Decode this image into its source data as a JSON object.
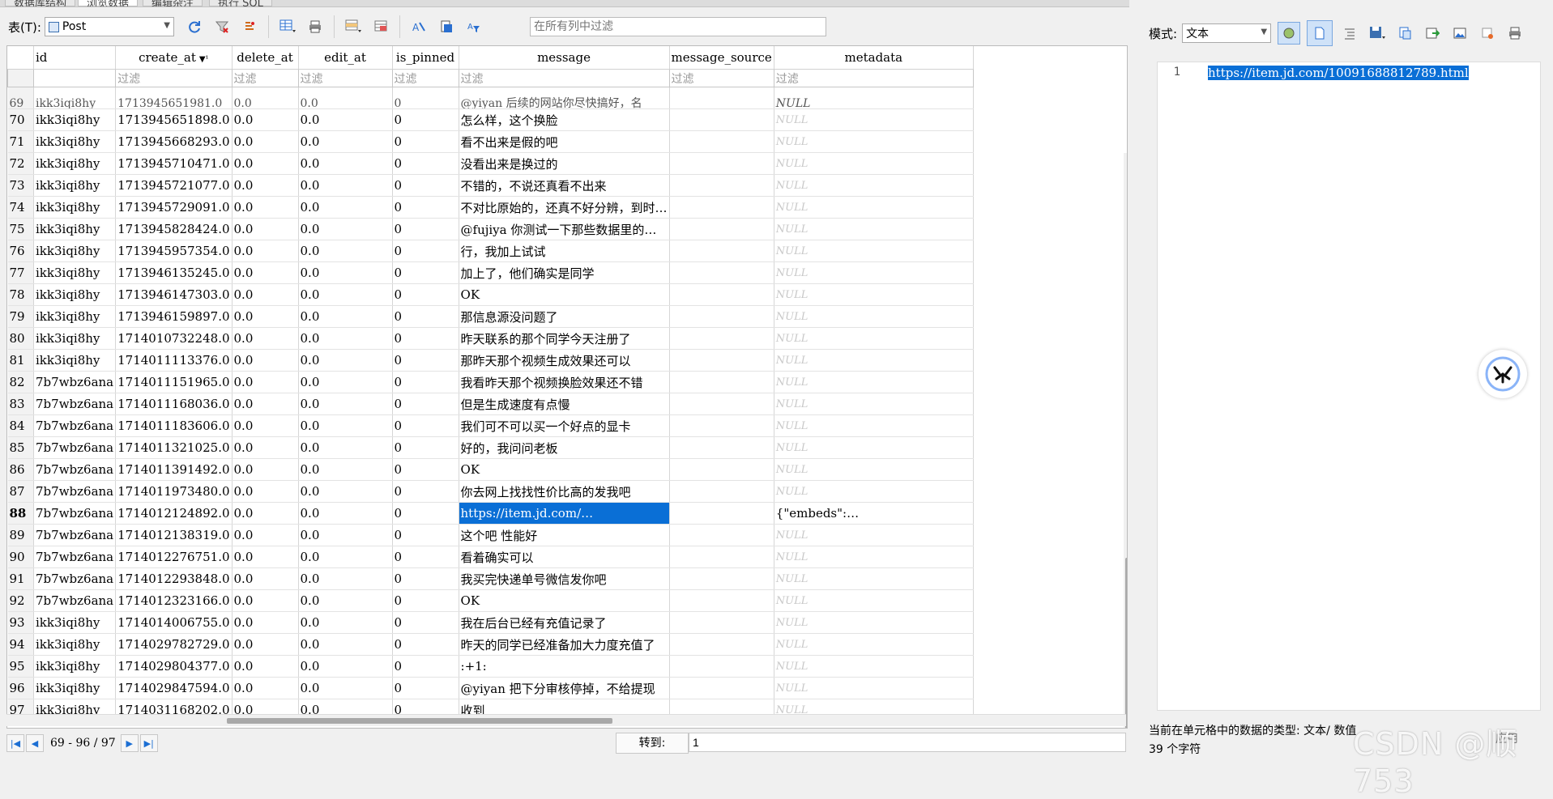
{
  "tabs": [
    {
      "label": "数据库结构"
    },
    {
      "label": "浏览数据",
      "active": true
    },
    {
      "label": "编辑杂注"
    },
    {
      "label": "执行 SQL"
    }
  ],
  "toolbar": {
    "table_label": "表(T):",
    "table_value": "Post",
    "filter_all_placeholder": "在所有列中过滤"
  },
  "grid": {
    "columns": [
      "id",
      "create_at",
      "delete_at",
      "edit_at",
      "is_pinned",
      "message",
      "message_source",
      "metadata"
    ],
    "sort_indicator": "▼¹",
    "filter_placeholder": "过滤",
    "partial_row": {
      "num": "69",
      "id": "ikk3iqi8hy",
      "create_at": "1713945651981.0",
      "delete_at": "0.0",
      "edit_at": "0.0",
      "is_pinned": "0",
      "message": "@yiyan 后续的网站你尽快搞好，名",
      "metadata": "NULL"
    },
    "null_text": "NULL",
    "rows": [
      {
        "num": "70",
        "id": "ikk3iqi8hy",
        "create_at": "1713945651898.0",
        "delete_at": "0.0",
        "edit_at": "0.0",
        "is_pinned": "0",
        "message": "怎么样，这个换脸",
        "message_source": "",
        "metadata": "NULL"
      },
      {
        "num": "71",
        "id": "ikk3iqi8hy",
        "create_at": "1713945668293.0",
        "delete_at": "0.0",
        "edit_at": "0.0",
        "is_pinned": "0",
        "message": "看不出来是假的吧",
        "message_source": "",
        "metadata": "NULL"
      },
      {
        "num": "72",
        "id": "ikk3iqi8hy",
        "create_at": "1713945710471.0",
        "delete_at": "0.0",
        "edit_at": "0.0",
        "is_pinned": "0",
        "message": "没看出来是换过的",
        "message_source": "",
        "metadata": "NULL"
      },
      {
        "num": "73",
        "id": "ikk3iqi8hy",
        "create_at": "1713945721077.0",
        "delete_at": "0.0",
        "edit_at": "0.0",
        "is_pinned": "0",
        "message": "不错的，不说还真看不出来",
        "message_source": "",
        "metadata": "NULL"
      },
      {
        "num": "74",
        "id": "ikk3iqi8hy",
        "create_at": "1713945729091.0",
        "delete_at": "0.0",
        "edit_at": "0.0",
        "is_pinned": "0",
        "message": "不对比原始的，还真不好分辨，到时…",
        "message_source": "",
        "metadata": "NULL"
      },
      {
        "num": "75",
        "id": "ikk3iqi8hy",
        "create_at": "1713945828424.0",
        "delete_at": "0.0",
        "edit_at": "0.0",
        "is_pinned": "0",
        "message": "@fujiya 你测试一下那些数据里的…",
        "message_source": "",
        "metadata": "NULL"
      },
      {
        "num": "76",
        "id": "ikk3iqi8hy",
        "create_at": "1713945957354.0",
        "delete_at": "0.0",
        "edit_at": "0.0",
        "is_pinned": "0",
        "message": "行，我加上试试",
        "message_source": "",
        "metadata": "NULL"
      },
      {
        "num": "77",
        "id": "ikk3iqi8hy",
        "create_at": "1713946135245.0",
        "delete_at": "0.0",
        "edit_at": "0.0",
        "is_pinned": "0",
        "message": "加上了，他们确实是同学",
        "message_source": "",
        "metadata": "NULL"
      },
      {
        "num": "78",
        "id": "ikk3iqi8hy",
        "create_at": "1713946147303.0",
        "delete_at": "0.0",
        "edit_at": "0.0",
        "is_pinned": "0",
        "message": "OK",
        "message_source": "",
        "metadata": "NULL"
      },
      {
        "num": "79",
        "id": "ikk3iqi8hy",
        "create_at": "1713946159897.0",
        "delete_at": "0.0",
        "edit_at": "0.0",
        "is_pinned": "0",
        "message": "那信息源没问题了",
        "message_source": "",
        "metadata": "NULL"
      },
      {
        "num": "80",
        "id": "ikk3iqi8hy",
        "create_at": "1714010732248.0",
        "delete_at": "0.0",
        "edit_at": "0.0",
        "is_pinned": "0",
        "message": "昨天联系的那个同学今天注册了",
        "message_source": "",
        "metadata": "NULL"
      },
      {
        "num": "81",
        "id": "ikk3iqi8hy",
        "create_at": "1714011113376.0",
        "delete_at": "0.0",
        "edit_at": "0.0",
        "is_pinned": "0",
        "message": "那昨天那个视频生成效果还可以",
        "message_source": "",
        "metadata": "NULL"
      },
      {
        "num": "82",
        "id": "7b7wbz6ana",
        "create_at": "1714011151965.0",
        "delete_at": "0.0",
        "edit_at": "0.0",
        "is_pinned": "0",
        "message": "我看昨天那个视频换脸效果还不错",
        "message_source": "",
        "metadata": "NULL"
      },
      {
        "num": "83",
        "id": "7b7wbz6ana",
        "create_at": "1714011168036.0",
        "delete_at": "0.0",
        "edit_at": "0.0",
        "is_pinned": "0",
        "message": "但是生成速度有点慢",
        "message_source": "",
        "metadata": "NULL"
      },
      {
        "num": "84",
        "id": "7b7wbz6ana",
        "create_at": "1714011183606.0",
        "delete_at": "0.0",
        "edit_at": "0.0",
        "is_pinned": "0",
        "message": "我们可不可以买一个好点的显卡",
        "message_source": "",
        "metadata": "NULL"
      },
      {
        "num": "85",
        "id": "7b7wbz6ana",
        "create_at": "1714011321025.0",
        "delete_at": "0.0",
        "edit_at": "0.0",
        "is_pinned": "0",
        "message": "好的，我问问老板",
        "message_source": "",
        "metadata": "NULL"
      },
      {
        "num": "86",
        "id": "7b7wbz6ana",
        "create_at": "1714011391492.0",
        "delete_at": "0.0",
        "edit_at": "0.0",
        "is_pinned": "0",
        "message": "OK",
        "message_source": "",
        "metadata": "NULL"
      },
      {
        "num": "87",
        "id": "7b7wbz6ana",
        "create_at": "1714011973480.0",
        "delete_at": "0.0",
        "edit_at": "0.0",
        "is_pinned": "0",
        "message": "你去网上找找性价比高的发我吧",
        "message_source": "",
        "metadata": "NULL"
      },
      {
        "num": "88",
        "id": "7b7wbz6ana",
        "create_at": "1714012124892.0",
        "delete_at": "0.0",
        "edit_at": "0.0",
        "is_pinned": "0",
        "message": "https://item.jd.com/…",
        "message_source": "",
        "metadata": "{\"embeds\":…",
        "current": true,
        "selected": true
      },
      {
        "num": "89",
        "id": "7b7wbz6ana",
        "create_at": "1714012138319.0",
        "delete_at": "0.0",
        "edit_at": "0.0",
        "is_pinned": "0",
        "message": "这个吧 性能好",
        "message_source": "",
        "metadata": "NULL"
      },
      {
        "num": "90",
        "id": "7b7wbz6ana",
        "create_at": "1714012276751.0",
        "delete_at": "0.0",
        "edit_at": "0.0",
        "is_pinned": "0",
        "message": "看着确实可以",
        "message_source": "",
        "metadata": "NULL"
      },
      {
        "num": "91",
        "id": "7b7wbz6ana",
        "create_at": "1714012293848.0",
        "delete_at": "0.0",
        "edit_at": "0.0",
        "is_pinned": "0",
        "message": "我买完快递单号微信发你吧",
        "message_source": "",
        "metadata": "NULL"
      },
      {
        "num": "92",
        "id": "7b7wbz6ana",
        "create_at": "1714012323166.0",
        "delete_at": "0.0",
        "edit_at": "0.0",
        "is_pinned": "0",
        "message": "OK",
        "message_source": "",
        "metadata": "NULL"
      },
      {
        "num": "93",
        "id": "ikk3iqi8hy",
        "create_at": "1714014006755.0",
        "delete_at": "0.0",
        "edit_at": "0.0",
        "is_pinned": "0",
        "message": "我在后台已经有充值记录了",
        "message_source": "",
        "metadata": "NULL"
      },
      {
        "num": "94",
        "id": "ikk3iqi8hy",
        "create_at": "1714029782729.0",
        "delete_at": "0.0",
        "edit_at": "0.0",
        "is_pinned": "0",
        "message": "昨天的同学已经准备加大力度充值了",
        "message_source": "",
        "metadata": "NULL"
      },
      {
        "num": "95",
        "id": "ikk3iqi8hy",
        "create_at": "1714029804377.0",
        "delete_at": "0.0",
        "edit_at": "0.0",
        "is_pinned": "0",
        "message": ":+1:",
        "message_source": "",
        "metadata": "NULL"
      },
      {
        "num": "96",
        "id": "ikk3iqi8hy",
        "create_at": "1714029847594.0",
        "delete_at": "0.0",
        "edit_at": "0.0",
        "is_pinned": "0",
        "message": "@yiyan 把下分审核停掉，不给提现",
        "message_source": "",
        "metadata": "NULL"
      },
      {
        "num": "97",
        "id": "ikk3iqi8hy",
        "create_at": "1714031168202.0",
        "delete_at": "0.0",
        "edit_at": "0.0",
        "is_pinned": "0",
        "message": "收到",
        "message_source": "",
        "metadata": "NULL"
      }
    ]
  },
  "nav": {
    "page_info": "69 - 96 / 97",
    "goto_label": "转到:",
    "goto_value": "1"
  },
  "editor": {
    "mode_label": "模式:",
    "mode_value": "文本",
    "line_number": "1",
    "content": "https://item.jd.com/10091688812789.html",
    "status_type": "当前在单元格中的数据的类型: 文本/ 数值",
    "status_chars": "39 个字符",
    "apply_label": "应用"
  },
  "watermark": "CSDN @顺753",
  "colors": {
    "selection": "#0a6fd6",
    "background": "#f0f0f0"
  }
}
